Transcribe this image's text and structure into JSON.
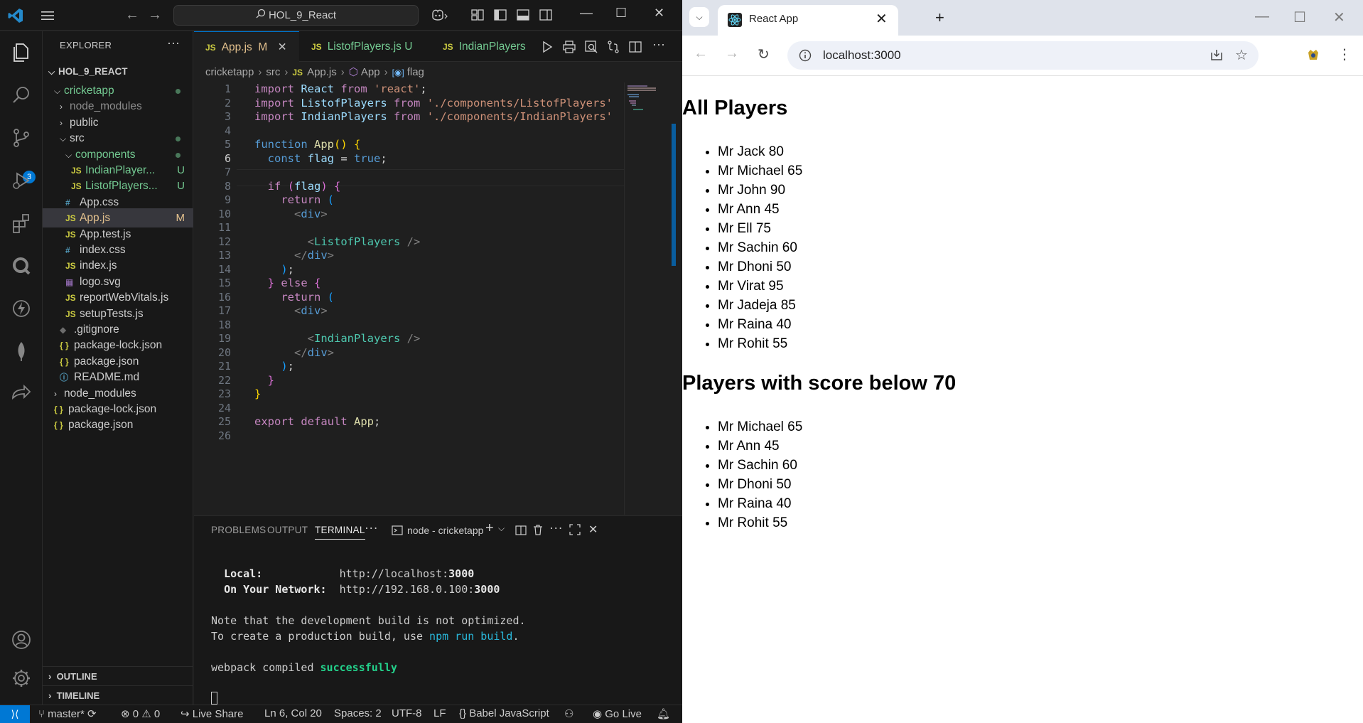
{
  "vscode": {
    "titlebar": {
      "search": "HOL_9_React"
    },
    "explorer": {
      "title": "EXPLORER",
      "workspace": "HOL_9_REACT",
      "items": [
        {
          "label": "cricketapp",
          "type": "folder",
          "open": true,
          "indent": 1,
          "color": "green",
          "dot": true
        },
        {
          "label": "node_modules",
          "type": "folder",
          "open": false,
          "indent": 2,
          "color": "grey"
        },
        {
          "label": "public",
          "type": "folder",
          "open": false,
          "indent": 2,
          "color": "normal"
        },
        {
          "label": "src",
          "type": "folder",
          "open": true,
          "indent": 2,
          "color": "normal",
          "dot": true
        },
        {
          "label": "components",
          "type": "folder",
          "open": true,
          "indent": 3,
          "color": "green",
          "dot": true
        },
        {
          "label": "IndianPlayer...",
          "type": "js",
          "indent": 4,
          "color": "green",
          "flag": "U"
        },
        {
          "label": "ListofPlayers...",
          "type": "js",
          "indent": 4,
          "color": "green",
          "flag": "U"
        },
        {
          "label": "App.css",
          "type": "css",
          "indent": 3,
          "color": "normal"
        },
        {
          "label": "App.js",
          "type": "js",
          "indent": 3,
          "color": "mod",
          "flag": "M",
          "selected": true
        },
        {
          "label": "App.test.js",
          "type": "js",
          "indent": 3,
          "color": "normal"
        },
        {
          "label": "index.css",
          "type": "css",
          "indent": 3,
          "color": "normal"
        },
        {
          "label": "index.js",
          "type": "js",
          "indent": 3,
          "color": "normal"
        },
        {
          "label": "logo.svg",
          "type": "svg",
          "indent": 3,
          "color": "normal"
        },
        {
          "label": "reportWebVitals.js",
          "type": "js",
          "indent": 3,
          "color": "normal"
        },
        {
          "label": "setupTests.js",
          "type": "js",
          "indent": 3,
          "color": "normal"
        },
        {
          "label": ".gitignore",
          "type": "git",
          "indent": 2,
          "color": "normal"
        },
        {
          "label": "package-lock.json",
          "type": "json",
          "indent": 2,
          "color": "normal"
        },
        {
          "label": "package.json",
          "type": "json",
          "indent": 2,
          "color": "normal"
        },
        {
          "label": "README.md",
          "type": "info",
          "indent": 2,
          "color": "normal"
        },
        {
          "label": "node_modules",
          "type": "folder",
          "open": false,
          "indent": 1,
          "color": "normal"
        },
        {
          "label": "package-lock.json",
          "type": "json",
          "indent": 1,
          "color": "normal"
        },
        {
          "label": "package.json",
          "type": "json",
          "indent": 1,
          "color": "normal"
        }
      ],
      "outline": "OUTLINE",
      "timeline": "TIMELINE"
    },
    "tabs": [
      {
        "label": "App.js",
        "flag": "M",
        "active": true
      },
      {
        "label": "ListofPlayers.js",
        "flag": "U",
        "active": false
      },
      {
        "label": "IndianPlayers",
        "flag": "",
        "active": false
      }
    ],
    "breadcrumb": [
      "cricketapp",
      "src",
      "App.js",
      "App",
      "flag"
    ],
    "code": {
      "lines": [
        "1",
        "2",
        "3",
        "4",
        "5",
        "6",
        "7",
        "8",
        "9",
        "10",
        "11",
        "12",
        "13",
        "14",
        "15",
        "16",
        "17",
        "18",
        "19",
        "20",
        "21",
        "22",
        "23",
        "24",
        "25",
        "26"
      ],
      "current_line": "6"
    },
    "panel": {
      "tabs": [
        "PROBLEMS",
        "OUTPUT",
        "TERMINAL"
      ],
      "terminal_name": "node - cricketapp",
      "local_label": "Local:",
      "local_url_prefix": "http://localhost:",
      "local_port": "3000",
      "network_label": "On Your Network:",
      "network_url_prefix": "http://192.168.0.100:",
      "network_port": "3000",
      "note1": "Note that the development build is not optimized.",
      "note2_prefix": "To create a production build, use ",
      "note2_cmd": "npm run build",
      "note2_suffix": ".",
      "compiled_prefix": "webpack compiled ",
      "compiled_status": "successfully"
    },
    "status": {
      "branch": "master*",
      "errors": "0",
      "warnings": "0",
      "live_share": "Live Share",
      "position": "Ln 6, Col 20",
      "spaces": "Spaces: 2",
      "encoding": "UTF-8",
      "eol": "LF",
      "language": "Babel JavaScript",
      "go_live": "Go Live"
    }
  },
  "browser": {
    "tab_title": "React App",
    "url": "localhost:3000",
    "heading1": "All Players",
    "all_players": [
      "Mr Jack 80",
      "Mr Michael 65",
      "Mr John 90",
      "Mr Ann 45",
      "Mr Ell 75",
      "Mr Sachin 60",
      "Mr Dhoni 50",
      "Mr Virat 95",
      "Mr Jadeja 85",
      "Mr Raina 40",
      "Mr Rohit 55"
    ],
    "heading2": "Players with score below 70",
    "below_70": [
      "Mr Michael 65",
      "Mr Ann 45",
      "Mr Sachin 60",
      "Mr Dhoni 50",
      "Mr Raina 40",
      "Mr Rohit 55"
    ]
  }
}
